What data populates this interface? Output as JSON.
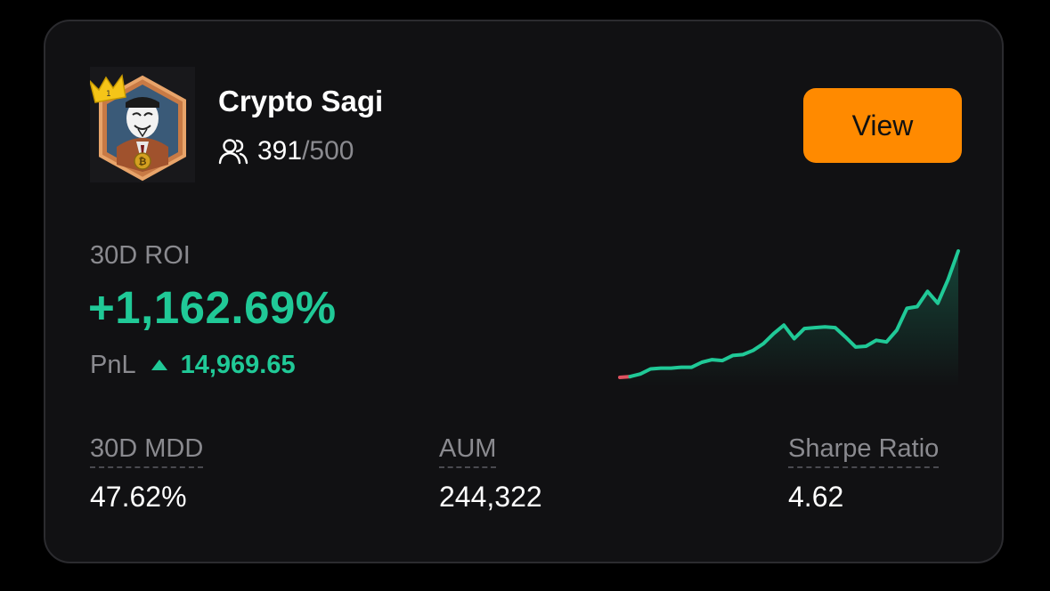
{
  "trader": {
    "name": "Crypto Sagi",
    "followers_count": "391",
    "followers_separator": "/",
    "followers_max": "500"
  },
  "actions": {
    "view_label": "View"
  },
  "roi": {
    "label": "30D ROI",
    "value": "+1,162.69%"
  },
  "pnl": {
    "label": "PnL",
    "value": "14,969.65"
  },
  "stats": {
    "mdd": {
      "label": "30D MDD",
      "value": "47.62%"
    },
    "aum": {
      "label": "AUM",
      "value": "244,322"
    },
    "sharpe": {
      "label": "Sharpe Ratio",
      "value": "4.62"
    }
  },
  "colors": {
    "accent": "#ff8a00",
    "positive": "#20c997",
    "negative": "#e05260",
    "muted": "#8a8a8f"
  },
  "icons": {
    "followers": "users-icon",
    "pnl_trend": "triangle-up-icon",
    "avatar": "masked-trader-avatar"
  },
  "chart_data": {
    "type": "line",
    "title": "",
    "xlabel": "",
    "ylabel": "",
    "grid": false,
    "values": [
      0,
      0.5,
      2,
      5,
      5.5,
      5.5,
      6,
      6,
      9,
      10.5,
      10,
      13,
      13.5,
      16,
      20,
      26,
      31,
      23,
      29,
      29.5,
      30,
      29.5,
      24,
      18,
      18.5,
      22,
      21,
      28,
      41,
      42,
      51,
      44,
      58,
      75
    ],
    "negative_segment_end_index": 1
  }
}
